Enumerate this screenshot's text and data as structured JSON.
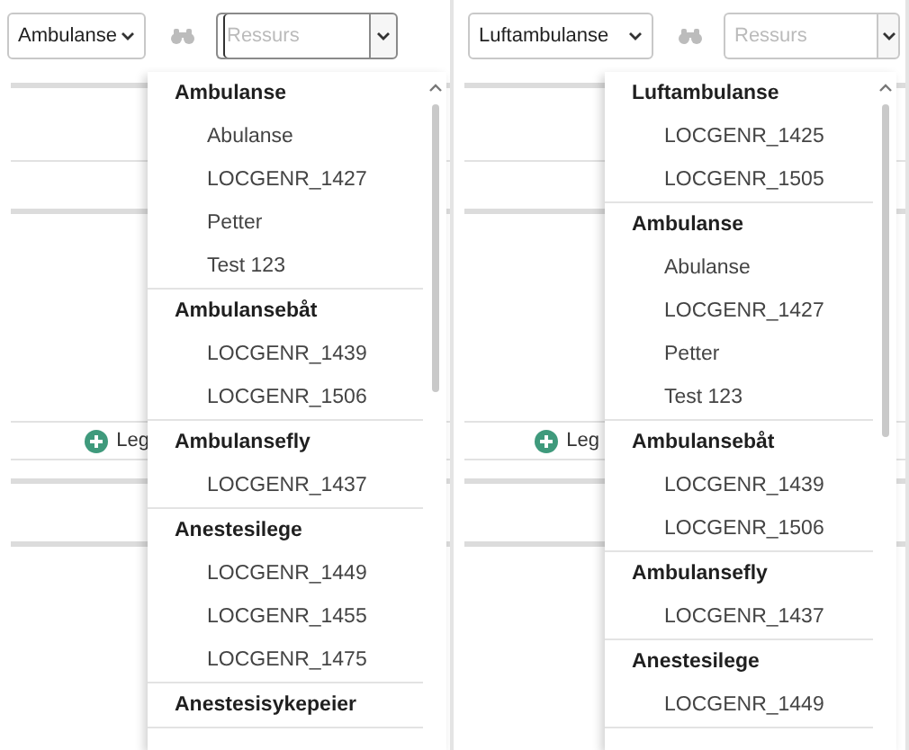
{
  "panels": [
    {
      "type_select": {
        "value": "Ambulanse"
      },
      "resource_field": {
        "placeholder": "Ressurs",
        "focused": true
      },
      "add_button": {
        "label": "Leg"
      },
      "dropdown": {
        "groups": [
          {
            "heading": "Ambulanse",
            "items": [
              "Abulanse",
              "LOCGENR_1427",
              "Petter",
              "Test 123"
            ]
          },
          {
            "heading": "Ambulansebåt",
            "items": [
              "LOCGENR_1439",
              "LOCGENR_1506"
            ]
          },
          {
            "heading": "Ambulansefly",
            "items": [
              "LOCGENR_1437"
            ]
          },
          {
            "heading": "Anestesilege",
            "items": [
              "LOCGENR_1449",
              "LOCGENR_1455",
              "LOCGENR_1475"
            ]
          },
          {
            "heading": "Anestesisykepeier"
          }
        ]
      }
    },
    {
      "type_select": {
        "value": "Luftambulanse"
      },
      "resource_field": {
        "placeholder": "Ressurs",
        "focused": false
      },
      "add_button": {
        "label": "Leg"
      },
      "dropdown": {
        "groups": [
          {
            "heading": "Luftambulanse",
            "items": [
              "LOCGENR_1425",
              "LOCGENR_1505"
            ]
          },
          {
            "heading": "Ambulanse",
            "items": [
              "Abulanse",
              "LOCGENR_1427",
              "Petter",
              "Test 123"
            ]
          },
          {
            "heading": "Ambulansebåt",
            "items": [
              "LOCGENR_1439",
              "LOCGENR_1506"
            ]
          },
          {
            "heading": "Ambulansefly",
            "items": [
              "LOCGENR_1437"
            ]
          },
          {
            "heading": "Anestesilege",
            "items": [
              "LOCGENR_1449"
            ]
          }
        ]
      }
    }
  ]
}
